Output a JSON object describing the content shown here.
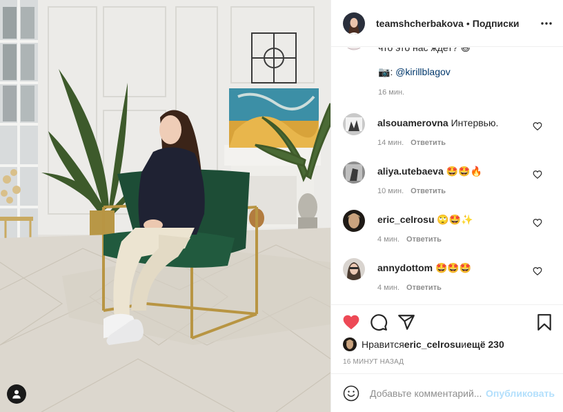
{
  "header": {
    "username": "teamshcherbakova",
    "separator": "•",
    "follow_status": "Подписки",
    "more_icon": "more-horizontal-icon"
  },
  "caption": {
    "line1": "что это нас ждет? 😄",
    "camera_emoji": "📷",
    "mention_prefix": ": ",
    "mention": "@kirillblagov",
    "time": "16 мин."
  },
  "comments": [
    {
      "user": "alsouamerovna",
      "text": "Интервью.",
      "time": "14 мин.",
      "reply": "Ответить"
    },
    {
      "user": "aliya.utebaeva",
      "text": "🤩🤩🔥",
      "time": "10 мин.",
      "reply": "Ответить"
    },
    {
      "user": "eric_celrosu",
      "text": "🙄🤩✨",
      "time": "4 мин.",
      "reply": "Ответить"
    },
    {
      "user": "annydottom",
      "text": "🤩🤩🤩",
      "time": "4 мин.",
      "reply": "Ответить"
    }
  ],
  "likes": {
    "prefix": "Нравится ",
    "user": "eric_celrosu",
    "middle": " и ",
    "others": "ещё 230"
  },
  "post_time": "16 МИНУТ НАЗАД",
  "add_comment": {
    "placeholder": "Добавьте комментарий...",
    "publish": "Опубликовать"
  },
  "colors": {
    "like_red": "#ed4956",
    "link_blue": "#00376b",
    "publish_disabled": "#b2dffc",
    "meta_gray": "#8e8e8e"
  }
}
